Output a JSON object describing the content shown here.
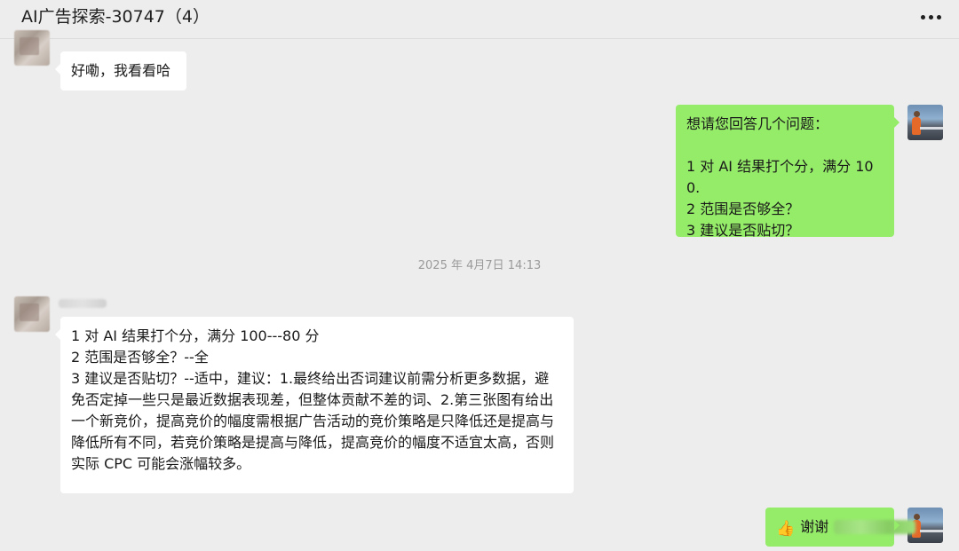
{
  "window": {
    "title": "AI广告探索-30747（4）"
  },
  "messages": {
    "m1": {
      "text": "好嘞，我看看哈"
    },
    "m2": {
      "text": "想请您回答几个问题：\n\n1 对 AI 结果打个分，满分 100.\n2 范围是否够全？\n3 建议是否贴切？"
    },
    "timestamp": "2025 年 4月7日 14:13",
    "m3": {
      "text": "1 对 AI 结果打个分，满分 100---80 分\n2 范围是否够全？--全\n3 建议是否贴切？--适中，建议：1.最终给出否词建议前需分析更多数据，避免否定掉一些只是最近数据表现差，但整体贡献不差的词、2.第三张图有给出一个新竞价，提高竞价的幅度需根据广告活动的竞价策略是只降低还是提高与降低所有不同，若竞价策略是提高与降低，提高竞价的幅度不适宜太高，否则实际 CPC 可能会涨幅较多。"
    },
    "m4": {
      "text": "谢谢",
      "emoji": "👍"
    }
  },
  "icons": {
    "more": "more-icon",
    "thumbs_up": "thumbs-up-icon"
  },
  "colors": {
    "background": "#ededed",
    "self_bubble": "#95ec69",
    "other_bubble": "#ffffff",
    "timestamp": "#9a9a9a"
  }
}
